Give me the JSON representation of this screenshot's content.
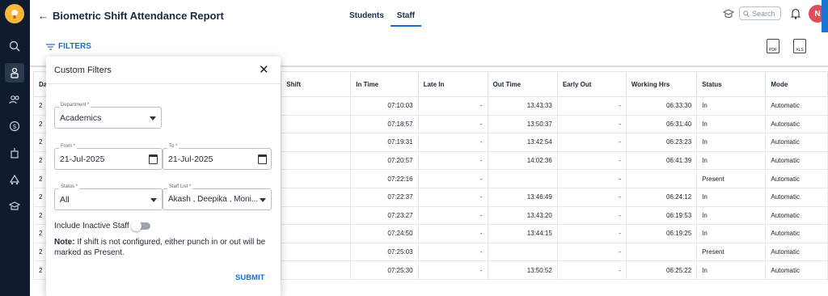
{
  "header": {
    "title": "Biometric Shift Attendance Report",
    "tabs": [
      {
        "label": "Students"
      },
      {
        "label": "Staff"
      }
    ],
    "search_placeholder": "Search",
    "avatar_initial": "N"
  },
  "toolbar": {
    "filters_label": "FILTERS",
    "pdf_label": "PDF",
    "xls_label": "XLS"
  },
  "table": {
    "columns": [
      "Da",
      "Shift",
      "In Time",
      "Late In",
      "Out Time",
      "Early Out",
      "Working Hrs",
      "Status",
      "Mode"
    ],
    "rows": [
      {
        "date": "2",
        "shift": "",
        "in_time": "07:10:03",
        "late_in": "-",
        "out_time": "13:43:33",
        "early_out": "-",
        "working_hrs": "06:33:30",
        "status": "In",
        "mode": "Automatic"
      },
      {
        "date": "2",
        "shift": "",
        "in_time": "07:18:57",
        "late_in": "-",
        "out_time": "13:50:37",
        "early_out": "-",
        "working_hrs": "06:31:40",
        "status": "In",
        "mode": "Automatic"
      },
      {
        "date": "2",
        "shift": "",
        "in_time": "07:19:31",
        "late_in": "-",
        "out_time": "13:42:54",
        "early_out": "-",
        "working_hrs": "06:23:23",
        "status": "In",
        "mode": "Automatic"
      },
      {
        "date": "2",
        "shift": "",
        "in_time": "07:20:57",
        "late_in": "-",
        "out_time": "14:02:36",
        "early_out": "-",
        "working_hrs": "06:41:39",
        "status": "In",
        "mode": "Automatic"
      },
      {
        "date": "2",
        "shift": "",
        "in_time": "07:22:16",
        "late_in": "-",
        "out_time": "",
        "early_out": "-",
        "working_hrs": "",
        "status": "Present",
        "mode": "Automatic"
      },
      {
        "date": "2",
        "shift": "",
        "in_time": "07:22:37",
        "late_in": "-",
        "out_time": "13:46:49",
        "early_out": "-",
        "working_hrs": "06:24:12",
        "status": "In",
        "mode": "Automatic"
      },
      {
        "date": "2",
        "shift": "",
        "in_time": "07:23:27",
        "late_in": "-",
        "out_time": "13:43:20",
        "early_out": "-",
        "working_hrs": "06:19:53",
        "status": "In",
        "mode": "Automatic"
      },
      {
        "date": "2",
        "shift": "",
        "in_time": "07:24:50",
        "late_in": "-",
        "out_time": "13:44:15",
        "early_out": "-",
        "working_hrs": "06:19:25",
        "status": "In",
        "mode": "Automatic"
      },
      {
        "date": "2",
        "shift": "",
        "in_time": "07:25:03",
        "late_in": "-",
        "out_time": "",
        "early_out": "-",
        "working_hrs": "",
        "status": "Present",
        "mode": "Automatic"
      },
      {
        "date": "2",
        "shift": "",
        "in_time": "07:25:30",
        "late_in": "-",
        "out_time": "13:50:52",
        "early_out": "-",
        "working_hrs": "06:25:22",
        "status": "In",
        "mode": "Automatic"
      }
    ]
  },
  "filters_popup": {
    "title": "Custom Filters",
    "department": {
      "label": "Department *",
      "value": "Academics"
    },
    "from": {
      "label": "From *",
      "value": "21-Jul-2025"
    },
    "to": {
      "label": "To *",
      "value": "21-Jul-2025"
    },
    "status": {
      "label": "Status *",
      "value": "All"
    },
    "staff_list": {
      "label": "Staff List *",
      "value": "Akash , Deepika , Moni..."
    },
    "include_inactive_label": "Include Inactive Staff",
    "note_prefix": "Note:",
    "note_text": " If shift is not configured, either punch in or out will be marked as Present.",
    "submit_label": "SUBMIT"
  },
  "colors": {
    "accent": "#1b6fc9",
    "sidebar": "#0f1c2e",
    "avatar": "#e04d5a"
  }
}
